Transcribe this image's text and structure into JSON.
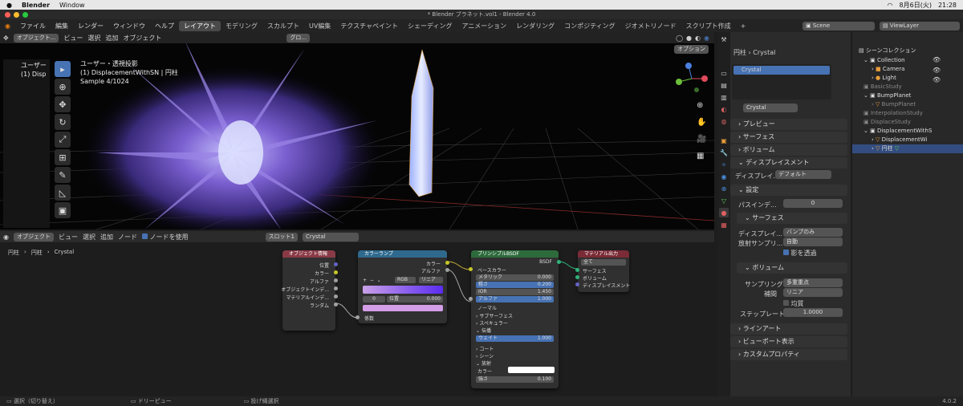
{
  "mac": {
    "app": "Blender",
    "menu": "Window",
    "date": "8月6日(火)",
    "time": "21:28"
  },
  "window_title": "* Blender ブラネット.vol1 - Blender 4.0",
  "menus": [
    "ファイル",
    "編集",
    "レンダー",
    "ウィンドウ",
    "ヘルプ"
  ],
  "workspaces": [
    "レイアウト",
    "モデリング",
    "スカルプト",
    "UV編集",
    "テクスチャペイント",
    "シェーディング",
    "アニメーション",
    "レンダリング",
    "コンポジティング",
    "ジオメトリノード",
    "スクリプト作成"
  ],
  "scene": "Scene",
  "view_layer": "ViewLayer",
  "viewport": {
    "mode": "オブジェクト...",
    "menus": [
      "ビュー",
      "選択",
      "追加",
      "オブジェクト"
    ],
    "orient": "グロ...",
    "options": "オプション",
    "overlay1": "ユーザー・透視投影",
    "overlay2": "(1) DisplacementWithSN | 円柱",
    "overlay3": "Sample 4/1024",
    "mini1": "ユーザー",
    "mini2": "(1) Disp"
  },
  "node_editor": {
    "mode": "オブジェクト",
    "menus": [
      "ビュー",
      "選択",
      "追加",
      "ノード"
    ],
    "use_nodes": "ノードを使用",
    "slot": "スロット1",
    "material": "Crystal",
    "breadcrumb": [
      "円柱",
      "円柱",
      "Crystal"
    ],
    "obj_info": {
      "title": "オブジェクト情報",
      "outs": [
        "位置",
        "カラー",
        "アルファ",
        "オブジェクトインデ...",
        "マテリアルインデ...",
        "ランダム"
      ]
    },
    "color_ramp": {
      "title": "カラーランプ",
      "mode": "RGB",
      "interp": "リニア",
      "idx": "0",
      "pos_label": "位置",
      "pos_val": "0.000",
      "fac": "係数",
      "outs": [
        "カラー",
        "アルファ"
      ]
    },
    "bsdf": {
      "title": "プリンシプルBSDF",
      "out": "BSDF",
      "base": "ベースカラー",
      "metal": "メタリック",
      "metal_v": "0.000",
      "rough": "粗さ",
      "rough_v": "0.200",
      "ior": "IOR",
      "ior_v": "1.450",
      "alpha": "アルファ",
      "alpha_v": "1.000",
      "normal": "ノーマル",
      "sss": "サブサーフェス",
      "spec": "スペキュラー",
      "trans": "伝播",
      "weight": "ウェイト",
      "weight_v": "1.000",
      "coat": "コート",
      "sheen": "シーン",
      "emit": "放射",
      "color": "カラー",
      "strength": "強さ",
      "strength_v": "0.100"
    },
    "output": {
      "title": "マテリアル出力",
      "target": "全て",
      "ins": [
        "サーフェス",
        "ボリューム",
        "ディスプレイスメント"
      ]
    }
  },
  "props": {
    "breadcrumb1": "円柱",
    "breadcrumb2": "Crystal",
    "slot": "Crystal",
    "mat": "Crystal",
    "panels": [
      "プレビュー",
      "サーフェス",
      "ボリューム",
      "ディスプレイスメント"
    ],
    "disp_label": "ディスプレイ...",
    "disp_val": "デフォルト",
    "settings": "設定",
    "pass_label": "パスインデ...",
    "pass_val": "0",
    "surface": "サーフェス",
    "disp2_label": "ディスプレイ...",
    "disp2_val": "バンプのみ",
    "radiance_label": "放射サンプリ...",
    "radiance_val": "自動",
    "transp": "影を透過",
    "volume": "ボリューム",
    "samp_label": "サンプリング",
    "samp_val": "多重重点",
    "interp_label": "補間",
    "interp_val": "リニア",
    "homog": "均質",
    "step_label": "ステップレート",
    "step_val": "1.0000",
    "lineart": "ラインアート",
    "viewport_disp": "ビューポート表示",
    "custom": "カスタムプロパティ"
  },
  "outliner": {
    "root": "シーンコレクション",
    "items": [
      "Collection",
      "Camera",
      "Light",
      "BasicStudy",
      "BumpPlanet",
      "BumpPlanet",
      "InterpolationStudy",
      "DisplaceStudy",
      "DisplacementWithS",
      "DisplacementWi",
      "円柱"
    ]
  },
  "status": {
    "select": "選択（切り替え）",
    "pan": "ドリーピュー",
    "lasso": "投げ縄選択",
    "version": "4.0.2"
  },
  "colors": {
    "accent": "#4772b3",
    "objinfo": "#8a3a46",
    "ramp": "#2f6a8e",
    "bsdf": "#2e6b3c",
    "output": "#7a2b36"
  }
}
